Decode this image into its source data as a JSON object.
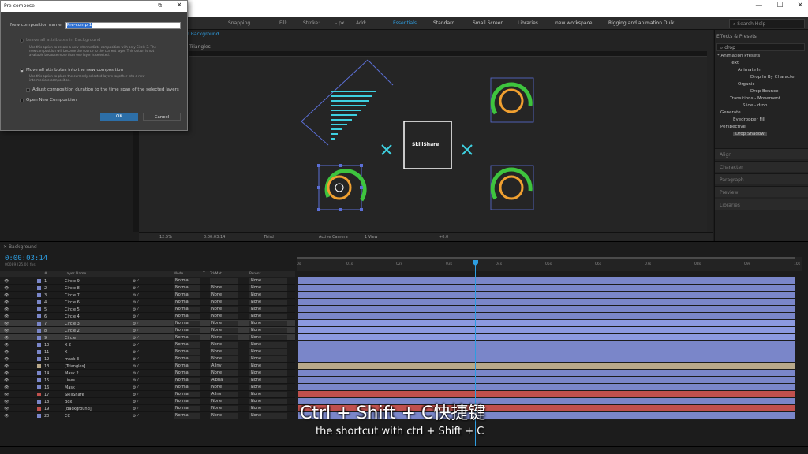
{
  "toolbar": {
    "snapping": "Snapping",
    "fill": "Fill:",
    "stroke": "Stroke:",
    "px": "- px",
    "add": "Add:",
    "workspaces": [
      "Essentials",
      "Standard",
      "Small Screen",
      "Libraries",
      "new workspace",
      "Rigging and animation Duik"
    ],
    "active_workspace": "Essentials",
    "search_placeholder": "Search Help"
  },
  "comp": {
    "tab": "n Background",
    "sub_tab": "Triangles",
    "center_label": "SkillShare",
    "footer": {
      "zoom": "12.5%",
      "time": "0:00:03:14",
      "resolution": "Third",
      "camera": "Active Camera",
      "view": "1 View",
      "offset": "+0.0"
    }
  },
  "dialog": {
    "title": "Pre-compose",
    "name_label": "New composition name:",
    "name_value": "Pre-comp 1",
    "opt1": "Leave all attributes in Background",
    "opt1_desc": "Use this option to create a new intermediate composition with only Circle 3. The new composition will become the source to the current layer. This option is not available because more than one layer is selected.",
    "opt2": "Move all attributes into the new composition",
    "opt2_desc": "Use this option to place the currently selected layers together into a new intermediate composition.",
    "opt3": "Adjust composition duration to the time span of the selected layers",
    "opt4": "Open New Composition",
    "ok": "OK",
    "cancel": "Cancel"
  },
  "effects": {
    "header": "Effects & Presets",
    "search": "drop",
    "tree": [
      "* Animation Presets",
      "Text",
      "Animate In",
      "Drop In By Character",
      "Organic",
      "Drop Bounce",
      "Transitions - Movement",
      "Slide - drop",
      "Generate",
      "Eyedropper Fill",
      "Perspective",
      "Drop Shadow"
    ],
    "panels": [
      "Align",
      "Character",
      "Paragraph",
      "Preview",
      "Libraries"
    ]
  },
  "timeline": {
    "tab": "Background",
    "timecode": "0:00:03:14",
    "fps": "00089 (25.00 fps)",
    "headers": {
      "num": "#",
      "name": "Layer Name",
      "mode": "Mode",
      "t": "T",
      "trkmat": "TrkMat",
      "parent": "Parent"
    },
    "ticks": [
      "0s",
      "01s",
      "02s",
      "03s",
      "04s",
      "05s",
      "06s",
      "07s",
      "08s",
      "09s",
      "10s"
    ],
    "layers": [
      {
        "num": "1",
        "name": "Circle 9",
        "mode": "Normal",
        "trk": "",
        "parent": "None",
        "color": "#7a86c9"
      },
      {
        "num": "2",
        "name": "Circle 8",
        "mode": "Normal",
        "trk": "None",
        "parent": "None",
        "color": "#7a86c9"
      },
      {
        "num": "3",
        "name": "Circle 7",
        "mode": "Normal",
        "trk": "None",
        "parent": "None",
        "color": "#7a86c9"
      },
      {
        "num": "4",
        "name": "Circle 6",
        "mode": "Normal",
        "trk": "None",
        "parent": "None",
        "color": "#7a86c9"
      },
      {
        "num": "5",
        "name": "Circle 5",
        "mode": "Normal",
        "trk": "None",
        "parent": "None",
        "color": "#7a86c9"
      },
      {
        "num": "6",
        "name": "Circle 4",
        "mode": "Normal",
        "trk": "None",
        "parent": "None",
        "color": "#7a86c9"
      },
      {
        "num": "7",
        "name": "Circle 3",
        "mode": "Normal",
        "trk": "None",
        "parent": "None",
        "color": "#7a86c9"
      },
      {
        "num": "8",
        "name": "Circle 2",
        "mode": "Normal",
        "trk": "None",
        "parent": "None",
        "color": "#7a86c9"
      },
      {
        "num": "9",
        "name": "Circle",
        "mode": "Normal",
        "trk": "None",
        "parent": "None",
        "color": "#7a86c9"
      },
      {
        "num": "10",
        "name": "X 2",
        "mode": "Normal",
        "trk": "None",
        "parent": "None",
        "color": "#7a86c9"
      },
      {
        "num": "11",
        "name": "X",
        "mode": "Normal",
        "trk": "None",
        "parent": "None",
        "color": "#7a86c9"
      },
      {
        "num": "12",
        "name": "mask 3",
        "mode": "Normal",
        "trk": "None",
        "parent": "None",
        "color": "#7a86c9"
      },
      {
        "num": "13",
        "name": "[Triangles]",
        "mode": "Normal",
        "trk": "A.Inv",
        "parent": "None",
        "color": "#b8a88a"
      },
      {
        "num": "14",
        "name": "Mask 2",
        "mode": "Normal",
        "trk": "None",
        "parent": "None",
        "color": "#7a86c9"
      },
      {
        "num": "15",
        "name": "Lines",
        "mode": "Normal",
        "trk": "Alpha",
        "parent": "None",
        "color": "#7a86c9"
      },
      {
        "num": "16",
        "name": "Mask",
        "mode": "Normal",
        "trk": "None",
        "parent": "None",
        "color": "#7a86c9"
      },
      {
        "num": "17",
        "name": "SkillShare",
        "mode": "Normal",
        "trk": "A.Inv",
        "parent": "None",
        "color": "#c0504d"
      },
      {
        "num": "18",
        "name": "Box",
        "mode": "Normal",
        "trk": "None",
        "parent": "None",
        "color": "#7a86c9"
      },
      {
        "num": "19",
        "name": "[Background]",
        "mode": "Normal",
        "trk": "None",
        "parent": "None",
        "color": "#c0504d"
      },
      {
        "num": "20",
        "name": "CC",
        "mode": "Normal",
        "trk": "None",
        "parent": "None",
        "color": "#7a86c9"
      }
    ],
    "selected": [
      "7",
      "8",
      "9"
    ]
  },
  "subtitles": {
    "cn": "Ctrl + Shift + C快捷键",
    "en": "the shortcut with ctrl + Shift + C"
  },
  "colors": {
    "accent": "#2d9de0",
    "shape_green": "#3ec43e",
    "shape_orange": "#f0a030",
    "shape_cyan": "#3ed0e0",
    "shape_blue": "#5b6fd6"
  }
}
